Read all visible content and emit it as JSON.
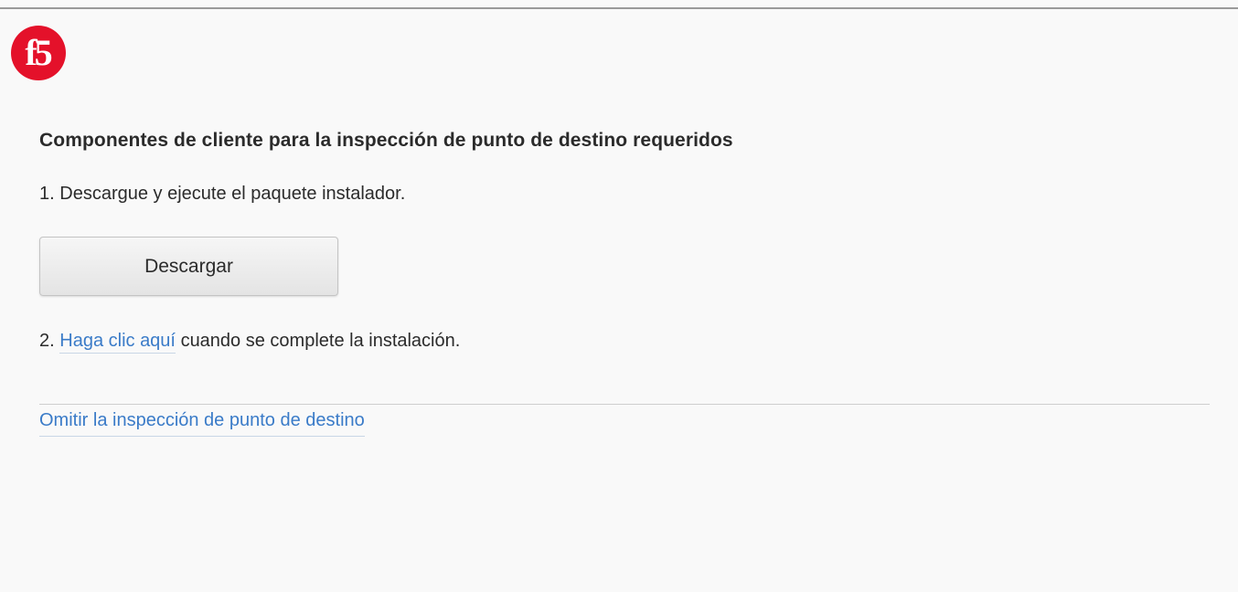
{
  "brand": {
    "logo_text": "f5",
    "logo_color": "#e4112a"
  },
  "page": {
    "heading": "Componentes de cliente para la inspección de punto de destino requeridos",
    "step1": {
      "number": "1.",
      "text": "Descargue y ejecute el paquete instalador."
    },
    "download_button_label": "Descargar",
    "step2": {
      "number": "2.",
      "link_text": "Haga clic aquí",
      "text": "cuando se complete la instalación."
    },
    "skip_link": "Omitir la inspección de punto de destino"
  },
  "colors": {
    "link": "#3a7bc8",
    "text": "#2b2b2b",
    "background": "#f9f9f9"
  }
}
